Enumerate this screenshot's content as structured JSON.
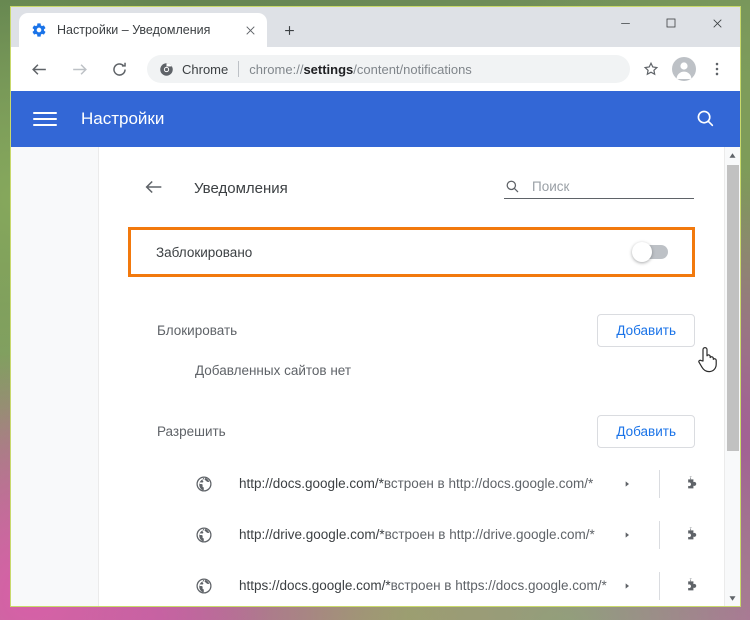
{
  "browser": {
    "tab": {
      "title": "Настройки – Уведомления",
      "favicon": "gear-icon",
      "close_label": "×"
    },
    "new_tab_label": "+",
    "window_controls": {
      "minimize": "–",
      "maximize": "□",
      "close": "✕"
    },
    "nav": {
      "back": "←",
      "forward": "→",
      "reload": "⟳"
    },
    "omnibox": {
      "chrome_label": "Chrome",
      "url_prefix": "chrome://",
      "url_strong": "settings",
      "url_suffix": "/content/notifications",
      "bookmark_icon": "star-icon",
      "profile_icon": "avatar-icon",
      "menu_icon": "three-dot-menu-icon"
    }
  },
  "settings": {
    "header": {
      "menu_icon": "hamburger-icon",
      "title": "Настройки",
      "search_icon": "search-icon"
    },
    "subpage": {
      "back_icon": "back-arrow-icon",
      "title": "Уведомления",
      "search": {
        "icon": "search-icon",
        "placeholder": "Поиск",
        "value": ""
      }
    },
    "toggle_row": {
      "label": "Заблокировано",
      "state": "off",
      "highlight_color": "#f2790d"
    },
    "block_section": {
      "title": "Блокировать",
      "add_label": "Добавить",
      "empty_text": "Добавленных сайтов нет"
    },
    "allow_section": {
      "title": "Разрешить",
      "add_label": "Добавить",
      "sites": [
        {
          "icon": "globe-icon",
          "url": "http://docs.google.com/*",
          "embedded": "встроен в http://docs.google.com/*",
          "chevron": "chevron-right-icon",
          "source_icon": "puzzle-piece-icon"
        },
        {
          "icon": "globe-icon",
          "url": "http://drive.google.com/*",
          "embedded": "встроен в http://drive.google.com/*",
          "chevron": "chevron-right-icon",
          "source_icon": "puzzle-piece-icon"
        },
        {
          "icon": "globe-icon",
          "url": "https://docs.google.com/*",
          "embedded": "встроен в https://docs.google.com/*",
          "chevron": "chevron-right-icon",
          "source_icon": "puzzle-piece-icon"
        }
      ]
    },
    "scrollbar": {
      "up_arrow": "▲",
      "down_arrow": "▼"
    }
  },
  "colors": {
    "header_blue": "#3367d6",
    "accent_blue": "#1a73e8",
    "highlight_orange": "#f2790d"
  }
}
